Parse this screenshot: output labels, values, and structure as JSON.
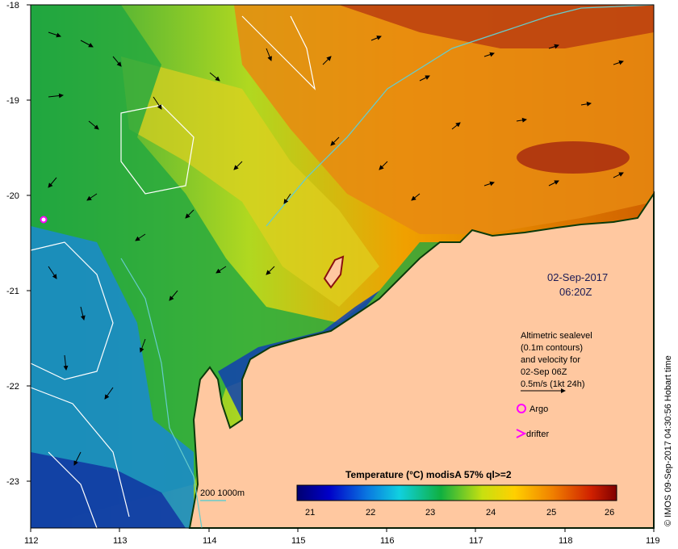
{
  "date": "02-Sep-2017",
  "time": "06:20Z",
  "info_lines": [
    "Altimetric sealevel",
    "(0.1m contours)",
    "and velocity for",
    "02-Sep 06Z",
    "0.5m/s (1kt 24h)"
  ],
  "legend": {
    "argo": "Argo",
    "drifter": "drifter",
    "depth": "200  1000m"
  },
  "colorbar": {
    "title": "Temperature (°C) modisA 57% ql>=2",
    "ticks": [
      "21",
      "22",
      "23",
      "24",
      "25",
      "26"
    ]
  },
  "axes": {
    "x_ticks": [
      "112",
      "113",
      "114",
      "115",
      "116",
      "117",
      "118",
      "119"
    ],
    "y_ticks": [
      "-18",
      "-19",
      "-20",
      "-21",
      "-22",
      "-23"
    ]
  },
  "credit": "© IMOS 09-Sep-2017 04:30:56 Hobart time",
  "colors": {
    "land": "#ffc8a0",
    "coastline": "#0a3a0a",
    "contour": "#ffffff",
    "bathymetry": "#66cccc",
    "argo": "#ff00ff"
  }
}
